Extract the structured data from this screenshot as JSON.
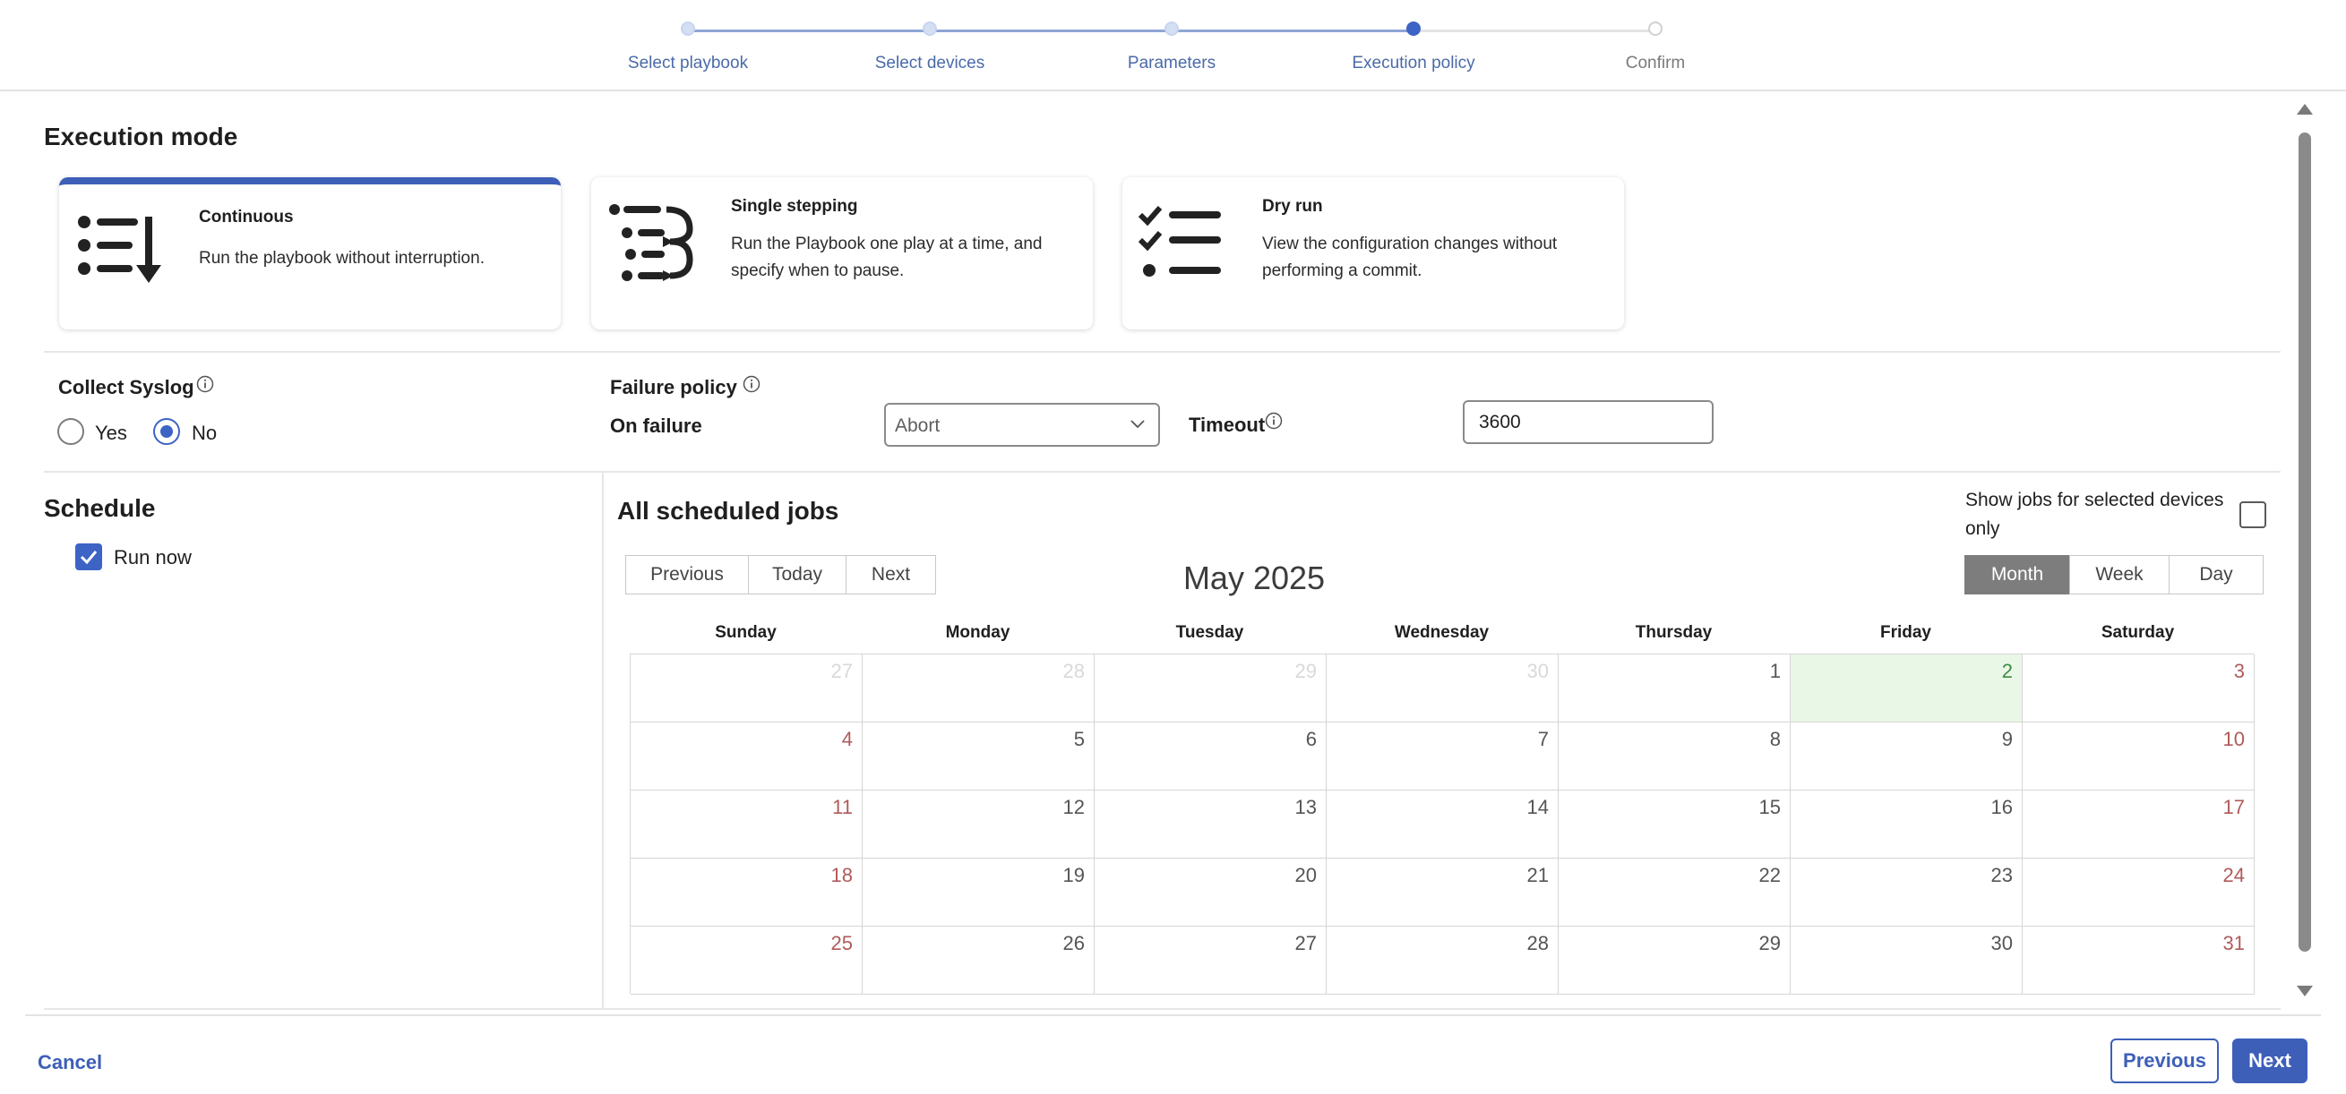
{
  "stepper": {
    "steps": [
      {
        "label": "Select playbook",
        "state": "done"
      },
      {
        "label": "Select devices",
        "state": "done"
      },
      {
        "label": "Parameters",
        "state": "done"
      },
      {
        "label": "Execution policy",
        "state": "active"
      },
      {
        "label": "Confirm",
        "state": "pending"
      }
    ]
  },
  "execution_mode": {
    "title": "Execution mode",
    "selected": "continuous",
    "modes": [
      {
        "title": "Continuous",
        "description": "Run the playbook without interruption.",
        "icon": "list-arrow-down-icon"
      },
      {
        "title": "Single stepping",
        "description": "Run the Playbook one play at a time, and specify when to pause.",
        "icon": "list-step-arrows-icon"
      },
      {
        "title": "Dry run",
        "description": "View the configuration changes without performing a commit.",
        "icon": "checklist-icon"
      }
    ]
  },
  "syslog": {
    "label": "Collect Syslog",
    "options": [
      {
        "label": "Yes",
        "checked": false
      },
      {
        "label": "No",
        "checked": true
      }
    ]
  },
  "failure_policy": {
    "label": "Failure policy",
    "on_failure_label": "On failure",
    "on_failure_value": "Abort",
    "timeout_label": "Timeout",
    "timeout_value": "3600"
  },
  "schedule": {
    "title": "Schedule",
    "run_now_label": "Run now",
    "run_now_checked": true
  },
  "jobs": {
    "title": "All scheduled jobs",
    "filter_label": "Show jobs for selected devices only",
    "filter_checked": false,
    "nav_buttons": [
      "Previous",
      "Today",
      "Next"
    ],
    "view_buttons": [
      "Month",
      "Week",
      "Day"
    ],
    "active_view": "Month",
    "month_title": "May 2025",
    "weekdays": [
      "Sunday",
      "Monday",
      "Tuesday",
      "Wednesday",
      "Thursday",
      "Friday",
      "Saturday"
    ],
    "days": [
      {
        "d": "27",
        "off": true
      },
      {
        "d": "28",
        "off": true
      },
      {
        "d": "29",
        "off": true
      },
      {
        "d": "30",
        "off": true
      },
      {
        "d": "1"
      },
      {
        "d": "2",
        "today": true
      },
      {
        "d": "3"
      },
      {
        "d": "4"
      },
      {
        "d": "5"
      },
      {
        "d": "6"
      },
      {
        "d": "7"
      },
      {
        "d": "8"
      },
      {
        "d": "9"
      },
      {
        "d": "10"
      },
      {
        "d": "11"
      },
      {
        "d": "12"
      },
      {
        "d": "13"
      },
      {
        "d": "14"
      },
      {
        "d": "15"
      },
      {
        "d": "16"
      },
      {
        "d": "17"
      },
      {
        "d": "18"
      },
      {
        "d": "19"
      },
      {
        "d": "20"
      },
      {
        "d": "21"
      },
      {
        "d": "22"
      },
      {
        "d": "23"
      },
      {
        "d": "24"
      },
      {
        "d": "25"
      },
      {
        "d": "26"
      },
      {
        "d": "27"
      },
      {
        "d": "28"
      },
      {
        "d": "29"
      },
      {
        "d": "30"
      },
      {
        "d": "31"
      }
    ]
  },
  "footer": {
    "cancel_label": "Cancel",
    "previous_label": "Previous",
    "next_label": "Next"
  },
  "colors": {
    "accent": "#3d5fb8",
    "today_bg": "#e9f8e6",
    "weekend_text": "#b05a5a"
  }
}
